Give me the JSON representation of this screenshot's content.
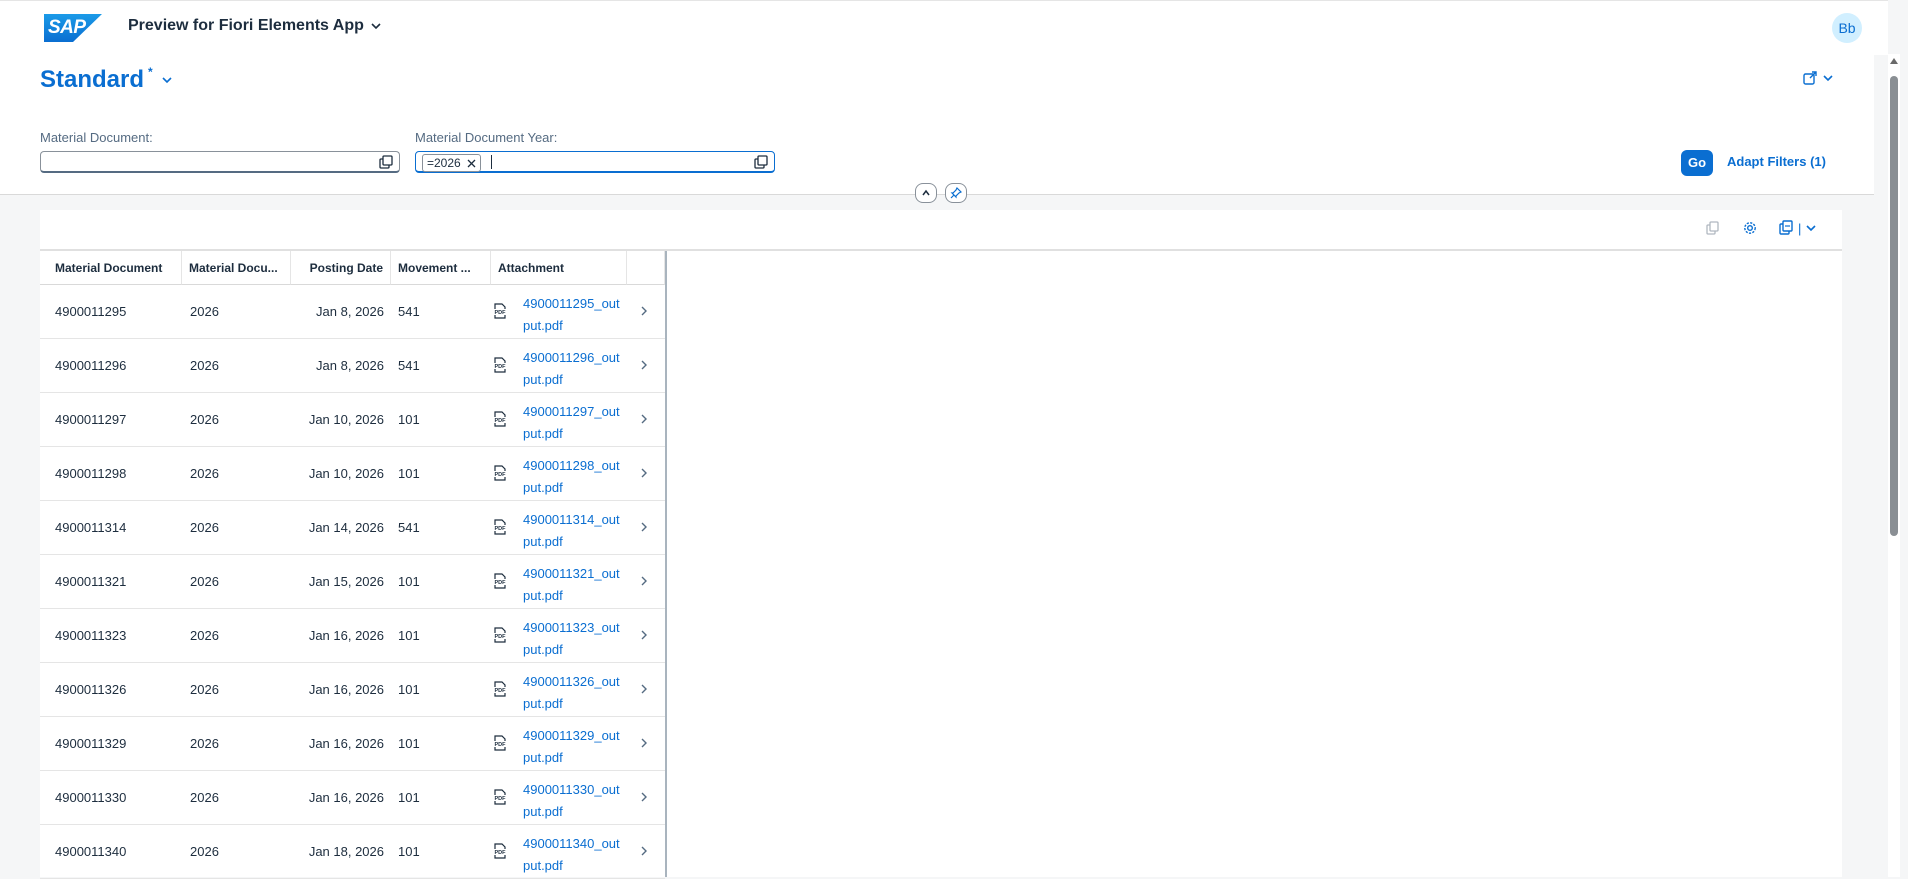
{
  "shell": {
    "logo_text": "SAP",
    "app_title": "Preview for Fiori Elements App",
    "avatar_initials": "Bb"
  },
  "header": {
    "variant_name": "Standard",
    "variant_modified_marker": "*",
    "filters": [
      {
        "label": "Material Document:",
        "value": "",
        "placeholder": ""
      },
      {
        "label": "Material Document Year:",
        "token": "=2026",
        "value": ""
      }
    ],
    "go_label": "Go",
    "adapt_filters_label": "Adapt Filters (1)"
  },
  "table": {
    "columns": [
      "Material Document",
      "Material Docu...",
      "Posting Date",
      "Movement ...",
      "Attachment"
    ],
    "rows": [
      {
        "doc": "4900011295",
        "year": "2026",
        "date": "Jan 8, 2026",
        "movement": "541",
        "attachment": "4900011295_output.pdf"
      },
      {
        "doc": "4900011296",
        "year": "2026",
        "date": "Jan 8, 2026",
        "movement": "541",
        "attachment": "4900011296_output.pdf"
      },
      {
        "doc": "4900011297",
        "year": "2026",
        "date": "Jan 10, 2026",
        "movement": "101",
        "attachment": "4900011297_output.pdf"
      },
      {
        "doc": "4900011298",
        "year": "2026",
        "date": "Jan 10, 2026",
        "movement": "101",
        "attachment": "4900011298_output.pdf"
      },
      {
        "doc": "4900011314",
        "year": "2026",
        "date": "Jan 14, 2026",
        "movement": "541",
        "attachment": "4900011314_output.pdf"
      },
      {
        "doc": "4900011321",
        "year": "2026",
        "date": "Jan 15, 2026",
        "movement": "101",
        "attachment": "4900011321_output.pdf"
      },
      {
        "doc": "4900011323",
        "year": "2026",
        "date": "Jan 16, 2026",
        "movement": "101",
        "attachment": "4900011323_output.pdf"
      },
      {
        "doc": "4900011326",
        "year": "2026",
        "date": "Jan 16, 2026",
        "movement": "101",
        "attachment": "4900011326_output.pdf"
      },
      {
        "doc": "4900011329",
        "year": "2026",
        "date": "Jan 16, 2026",
        "movement": "101",
        "attachment": "4900011329_output.pdf"
      },
      {
        "doc": "4900011330",
        "year": "2026",
        "date": "Jan 16, 2026",
        "movement": "101",
        "attachment": "4900011330_output.pdf"
      },
      {
        "doc": "4900011340",
        "year": "2026",
        "date": "Jan 18, 2026",
        "movement": "101",
        "attachment": "4900011340_output.pdf"
      }
    ]
  },
  "icons": {
    "value_help": "value-help-icon",
    "collapse": "chevron-up-icon",
    "pin": "pin-icon",
    "copy": "copy-icon",
    "settings": "gear-icon",
    "export": "export-icon",
    "share": "share-icon",
    "row_nav": "chevron-right-icon",
    "file": "pdf-icon"
  },
  "colors": {
    "accent": "#0a6ed1",
    "text": "#1d2d3e",
    "background": "#f5f6f7"
  }
}
